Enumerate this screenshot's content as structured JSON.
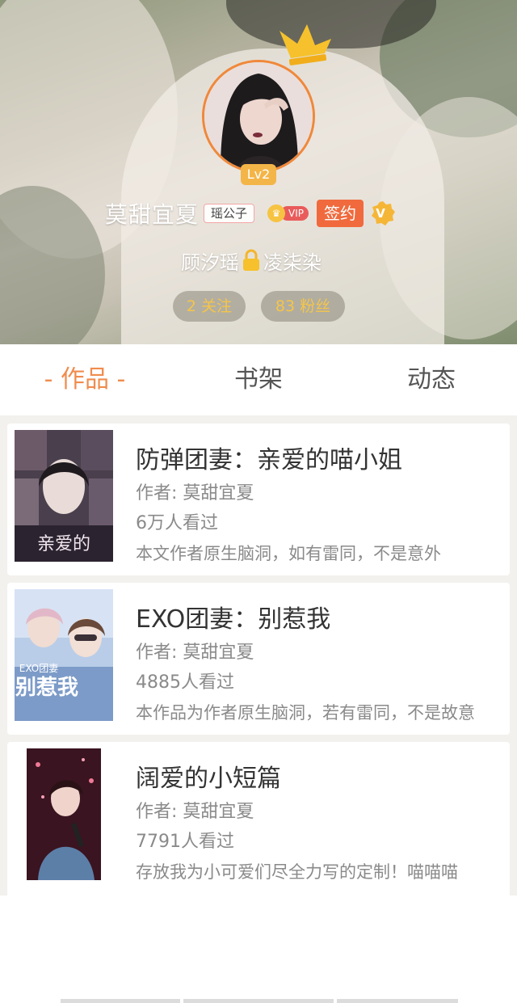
{
  "profile": {
    "level": "Lv2",
    "name": "莫甜宜夏",
    "title_tag": "瑶公子",
    "vip_label": "VIP",
    "signed_label": "签约",
    "couple": {
      "left": "顾汐瑶",
      "right": "凌柒染"
    },
    "following": "2 关注",
    "fans": "83 粉丝",
    "accent_color": "#f08c4e"
  },
  "tabs": [
    {
      "label": "- 作品 -",
      "active": true
    },
    {
      "label": "书架",
      "active": false
    },
    {
      "label": "动态",
      "active": false
    }
  ],
  "books": [
    {
      "title": "防弹团妻：亲爱的喵小姐",
      "author": "作者: 莫甜宜夏",
      "views": "6万人看过",
      "description": "本文作者原生脑洞，如有雷同，不是意外"
    },
    {
      "title": "EXO团妻：别惹我",
      "author": "作者: 莫甜宜夏",
      "views": "4885人看过",
      "description": "本作品为作者原生脑洞，若有雷同，不是故意"
    },
    {
      "title": "阔爱的小短篇",
      "author": "作者: 莫甜宜夏",
      "views": "7791人看过",
      "description": "存放我为小可爱们尽全力写的定制！喵喵喵"
    }
  ],
  "icons": {
    "crown": "crown-icon",
    "lock": "lock-icon",
    "verified": "verified-v-icon",
    "vip": "vip-crown-icon"
  }
}
